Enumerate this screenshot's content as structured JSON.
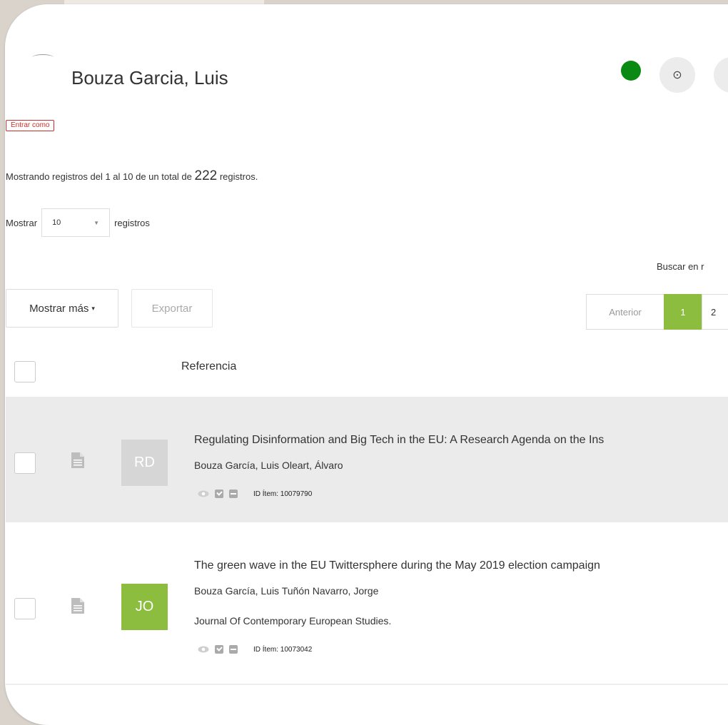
{
  "profile": {
    "name": "Bouza Garcia, Luis",
    "status_color": "#0a8a12"
  },
  "actions": {
    "entrar_como": "Entrar como"
  },
  "listing": {
    "prefix": "Mostrando registros del 1 al 10 de un total de",
    "total": "222",
    "suffix": "registros."
  },
  "page_length": {
    "label_before": "Mostrar",
    "value": "10",
    "label_after": "registros"
  },
  "search": {
    "label": "Buscar en r"
  },
  "toolbar": {
    "more_label": "Mostrar más",
    "export_label": "Exportar"
  },
  "pagination": {
    "prev": "Anterior",
    "pages": [
      "1",
      "2"
    ],
    "active": "1"
  },
  "table": {
    "header": "Referencia",
    "rows": [
      {
        "initials": "RD",
        "title": "Regulating Disinformation and Big Tech in the EU: A Research Agenda on the Ins",
        "authors": "Bouza García, Luis Oleart, Álvaro",
        "journal": "",
        "id_label": "ID Ítem:",
        "id": "10079790"
      },
      {
        "initials": "JO",
        "title": "The green wave in the EU Twittersphere during the May 2019 election campaign",
        "authors": "Bouza García, Luis Tuñón Navarro, Jorge",
        "journal": "Journal Of Contemporary European Studies.",
        "id_label": "ID Ítem:",
        "id": "10073042"
      }
    ]
  },
  "colors": {
    "accent_green": "#8cbd3f",
    "danger_red": "#c9302c",
    "row_highlight": "#ebebeb"
  },
  "icons": [
    "help-icon",
    "document-icon",
    "eye-icon",
    "checkbox-icon",
    "minus-icon",
    "caret-down-icon"
  ]
}
